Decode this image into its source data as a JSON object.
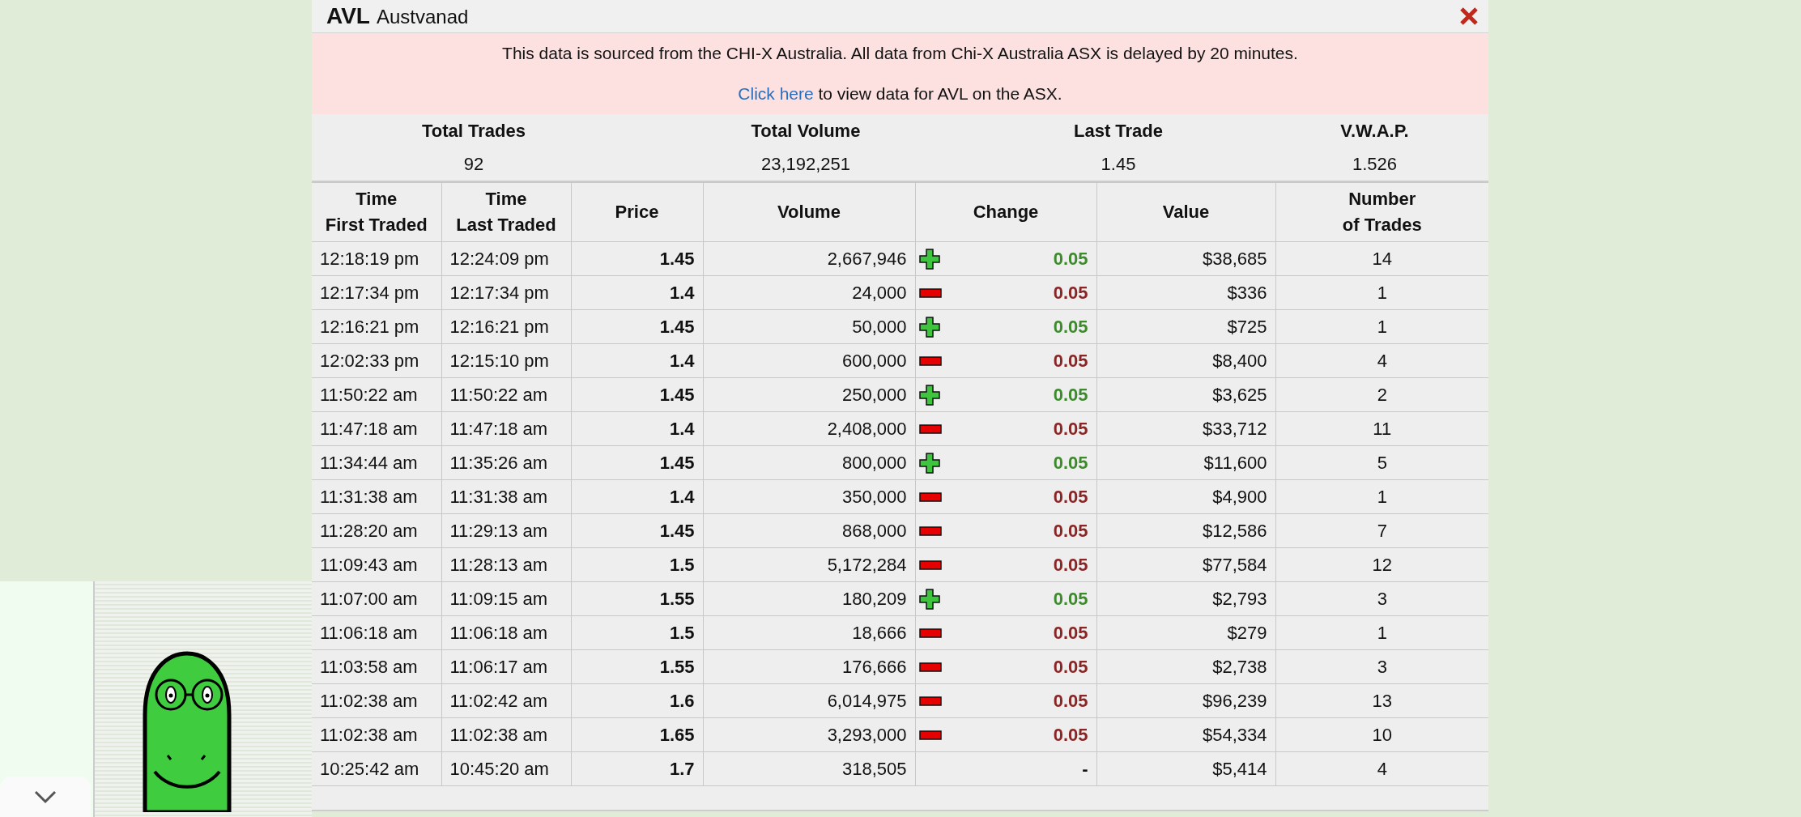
{
  "panel": {
    "code": "AVL",
    "name": "Austvanad",
    "notice": "This data is sourced from the CHI-X Australia. All data from Chi-X Australia ASX is delayed by 20 minutes.",
    "link": "Click here",
    "link_suffix": " to view data for AVL on the ASX."
  },
  "summary": [
    {
      "label": "Total Trades",
      "value": "92"
    },
    {
      "label": "Total Volume",
      "value": "23,192,251"
    },
    {
      "label": "Last Trade",
      "value": "1.45"
    },
    {
      "label": "V.W.A.P.",
      "value": "1.526"
    }
  ],
  "table": {
    "columns": [
      [
        "Time",
        "First Traded"
      ],
      [
        "Time",
        "Last Traded"
      ],
      [
        "Price"
      ],
      [
        "Volume"
      ],
      [
        "Change"
      ],
      [
        "Value"
      ],
      [
        "Number",
        "of Trades"
      ]
    ],
    "rows": [
      {
        "first": "12:18:19 pm",
        "last": "12:24:09 pm",
        "price": "1.45",
        "volume": "2,667,946",
        "kind": "up",
        "change": "0.05",
        "value": "$38,685",
        "trades": "14"
      },
      {
        "first": "12:17:34 pm",
        "last": "12:17:34 pm",
        "price": "1.4",
        "volume": "24,000",
        "kind": "down",
        "change": "0.05",
        "value": "$336",
        "trades": "1"
      },
      {
        "first": "12:16:21 pm",
        "last": "12:16:21 pm",
        "price": "1.45",
        "volume": "50,000",
        "kind": "up",
        "change": "0.05",
        "value": "$725",
        "trades": "1"
      },
      {
        "first": "12:02:33 pm",
        "last": "12:15:10 pm",
        "price": "1.4",
        "volume": "600,000",
        "kind": "down",
        "change": "0.05",
        "value": "$8,400",
        "trades": "4"
      },
      {
        "first": "11:50:22 am",
        "last": "11:50:22 am",
        "price": "1.45",
        "volume": "250,000",
        "kind": "up",
        "change": "0.05",
        "value": "$3,625",
        "trades": "2"
      },
      {
        "first": "11:47:18 am",
        "last": "11:47:18 am",
        "price": "1.4",
        "volume": "2,408,000",
        "kind": "down",
        "change": "0.05",
        "value": "$33,712",
        "trades": "11"
      },
      {
        "first": "11:34:44 am",
        "last": "11:35:26 am",
        "price": "1.45",
        "volume": "800,000",
        "kind": "up",
        "change": "0.05",
        "value": "$11,600",
        "trades": "5"
      },
      {
        "first": "11:31:38 am",
        "last": "11:31:38 am",
        "price": "1.4",
        "volume": "350,000",
        "kind": "down",
        "change": "0.05",
        "value": "$4,900",
        "trades": "1"
      },
      {
        "first": "11:28:20 am",
        "last": "11:29:13 am",
        "price": "1.45",
        "volume": "868,000",
        "kind": "down",
        "change": "0.05",
        "value": "$12,586",
        "trades": "7"
      },
      {
        "first": "11:09:43 am",
        "last": "11:28:13 am",
        "price": "1.5",
        "volume": "5,172,284",
        "kind": "down",
        "change": "0.05",
        "value": "$77,584",
        "trades": "12"
      },
      {
        "first": "11:07:00 am",
        "last": "11:09:15 am",
        "price": "1.55",
        "volume": "180,209",
        "kind": "up",
        "change": "0.05",
        "value": "$2,793",
        "trades": "3"
      },
      {
        "first": "11:06:18 am",
        "last": "11:06:18 am",
        "price": "1.5",
        "volume": "18,666",
        "kind": "down",
        "change": "0.05",
        "value": "$279",
        "trades": "1"
      },
      {
        "first": "11:03:58 am",
        "last": "11:06:17 am",
        "price": "1.55",
        "volume": "176,666",
        "kind": "down",
        "change": "0.05",
        "value": "$2,738",
        "trades": "3"
      },
      {
        "first": "11:02:38 am",
        "last": "11:02:42 am",
        "price": "1.6",
        "volume": "6,014,975",
        "kind": "down",
        "change": "0.05",
        "value": "$96,239",
        "trades": "13"
      },
      {
        "first": "11:02:38 am",
        "last": "11:02:38 am",
        "price": "1.65",
        "volume": "3,293,000",
        "kind": "down",
        "change": "0.05",
        "value": "$54,334",
        "trades": "10"
      },
      {
        "first": "10:25:42 am",
        "last": "10:45:20 am",
        "price": "1.7",
        "volume": "318,505",
        "kind": "none",
        "change": "-",
        "value": "$5,414",
        "trades": "4"
      }
    ]
  }
}
